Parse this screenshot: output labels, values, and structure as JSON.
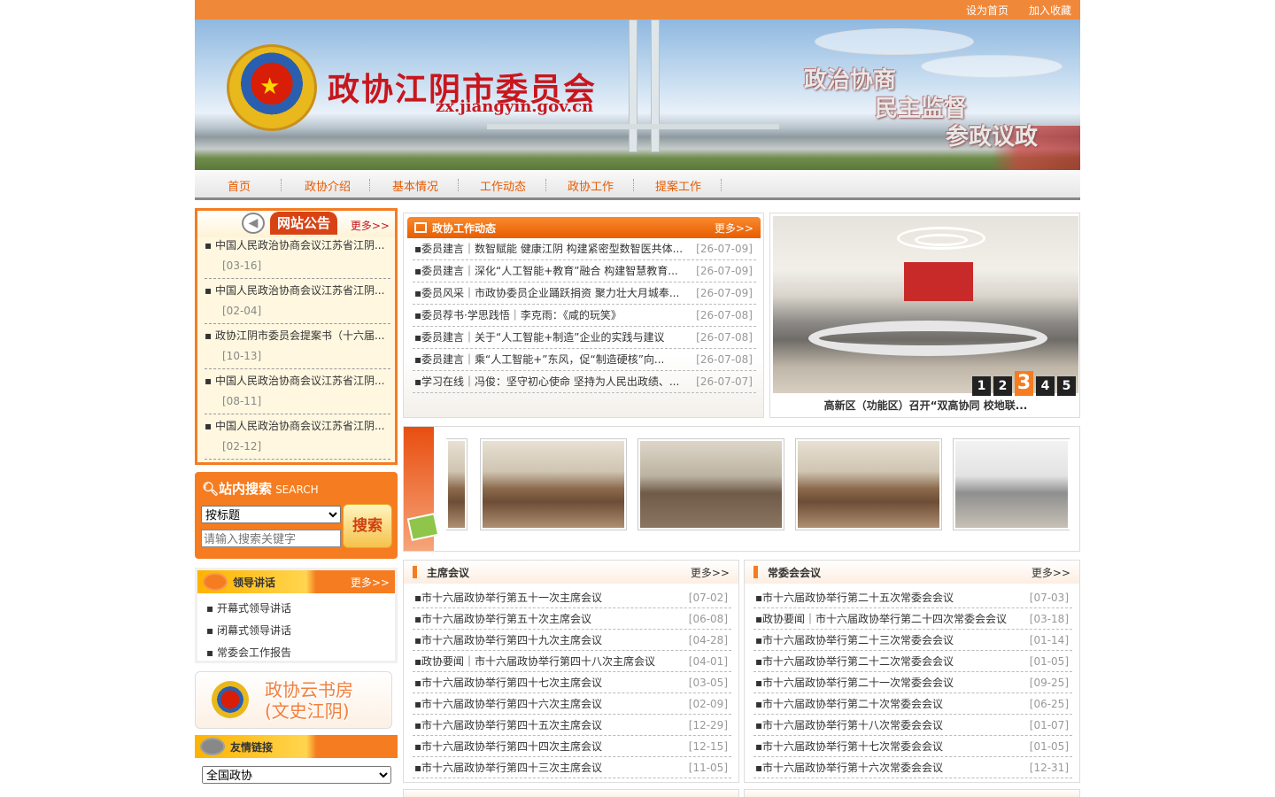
{
  "top_links": [
    "设为首页",
    "加入收藏"
  ],
  "banner": {
    "title": "政协江阴市委员会",
    "url": "zx.jiangyin.gov.cn",
    "slogans": [
      "政治协商",
      "民主监督",
      "参政议政"
    ]
  },
  "nav": [
    "首页",
    "政协介绍",
    "基本情况",
    "工作动态",
    "政协工作",
    "提案工作"
  ],
  "notice": {
    "title": "网站公告",
    "more": "更多>>",
    "items": [
      {
        "text": "中国人民政治协商会议江苏省江阴...",
        "date": "[03-16]"
      },
      {
        "text": "中国人民政治协商会议江苏省江阴...",
        "date": "[02-04]"
      },
      {
        "text": "政协江阴市委员会提案书（十六届...",
        "date": "[10-13]"
      },
      {
        "text": "中国人民政治协商会议江苏省江阴...",
        "date": "[08-11]"
      },
      {
        "text": "中国人民政治协商会议江苏省江阴...",
        "date": "[02-12]"
      }
    ]
  },
  "search": {
    "title": "站内搜索",
    "title_en": "SEARCH",
    "select": "按标题",
    "placeholder": "请输入搜索关键字",
    "button": "搜索"
  },
  "lead": {
    "title": "领导讲话",
    "more": "更多>>",
    "items": [
      "开幕式领导讲话",
      "闭幕式领导讲话",
      "常委会工作报告"
    ]
  },
  "cloud": {
    "line1": "政协云书房",
    "line2": "(文史江阴)"
  },
  "friend": {
    "title": "友情链接",
    "select": "全国政协"
  },
  "news": {
    "title": "政协工作动态",
    "more": "更多>>",
    "items": [
      {
        "text": "委员建言｜数智赋能 健康江阴 构建紧密型数智医共体...",
        "date": "[26-07-09]"
      },
      {
        "text": "委员建言｜深化“人工智能+教育”融合 构建智慧教育...",
        "date": "[26-07-09]"
      },
      {
        "text": "委员风采｜市政协委员企业踊跃捐资 聚力壮大月城奉...",
        "date": "[26-07-09]"
      },
      {
        "text": "委员荐书·学思践悟｜李克雨：《咸的玩笑》",
        "date": "[26-07-08]"
      },
      {
        "text": "委员建言｜关于“人工智能+制造”企业的实践与建议",
        "date": "[26-07-08]"
      },
      {
        "text": "委员建言｜乘“人工智能+”东风，促“制造硬核”向...",
        "date": "[26-07-08]"
      },
      {
        "text": "学习在线｜冯俊：坚守初心使命 坚持为人民出政绩、...",
        "date": "[26-07-07]"
      }
    ]
  },
  "photo": {
    "caption": "高新区（功能区）召开“双高协同 校地联...",
    "pages": [
      "1",
      "2",
      "3",
      "4",
      "5"
    ],
    "active": "3"
  },
  "zhuxi": {
    "title": "主席会议",
    "more": "更多>>",
    "items": [
      {
        "text": "市十六届政协举行第五十一次主席会议",
        "date": "[07-02]"
      },
      {
        "text": "市十六届政协举行第五十次主席会议",
        "date": "[06-08]"
      },
      {
        "text": "市十六届政协举行第四十九次主席会议",
        "date": "[04-28]"
      },
      {
        "text": "政协要闻｜市十六届政协举行第四十八次主席会议",
        "date": "[04-01]"
      },
      {
        "text": "市十六届政协举行第四十七次主席会议",
        "date": "[03-05]"
      },
      {
        "text": "市十六届政协举行第四十六次主席会议",
        "date": "[02-09]"
      },
      {
        "text": "市十六届政协举行第四十五次主席会议",
        "date": "[12-29]"
      },
      {
        "text": "市十六届政协举行第四十四次主席会议",
        "date": "[12-15]"
      },
      {
        "text": "市十六届政协举行第四十三次主席会议",
        "date": "[11-05]"
      }
    ]
  },
  "changwei": {
    "title": "常委会会议",
    "more": "更多>>",
    "items": [
      {
        "text": "市十六届政协举行第二十五次常委会会议",
        "date": "[07-03]"
      },
      {
        "text": "政协要闻｜市十六届政协举行第二十四次常委会会议",
        "date": "[03-18]"
      },
      {
        "text": "市十六届政协举行第二十三次常委会会议",
        "date": "[01-14]"
      },
      {
        "text": "市十六届政协举行第二十二次常委会会议",
        "date": "[01-05]"
      },
      {
        "text": "市十六届政协举行第二十一次常委会会议",
        "date": "[09-25]"
      },
      {
        "text": "市十六届政协举行第二十次常委会会议",
        "date": "[06-25]"
      },
      {
        "text": "市十六届政协举行第十八次常委会会议",
        "date": "[01-07]"
      },
      {
        "text": "市十六届政协举行第十七次常委会会议",
        "date": "[01-05]"
      },
      {
        "text": "市十六届政协举行第十六次常委会会议",
        "date": "[12-31]"
      }
    ]
  }
}
